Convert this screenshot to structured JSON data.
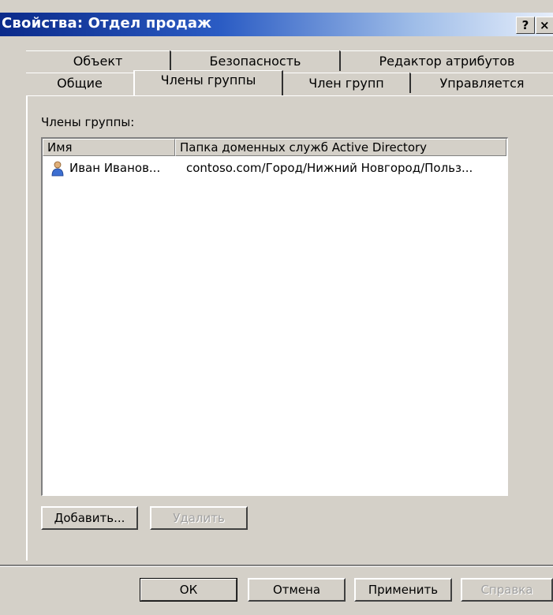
{
  "window": {
    "title": "Свойства: Отдел продаж",
    "help_label": "?",
    "close_label": "×"
  },
  "tabs": {
    "row1": [
      {
        "label": "Объект"
      },
      {
        "label": "Безопасность"
      },
      {
        "label": "Редактор атрибутов"
      }
    ],
    "row2": [
      {
        "label": "Общие"
      },
      {
        "label": "Члены группы",
        "active": true
      },
      {
        "label": "Член групп"
      },
      {
        "label": "Управляется"
      }
    ]
  },
  "members": {
    "caption": "Члены группы:",
    "columns": [
      "Имя",
      "Папка доменных служб Active Directory"
    ],
    "rows": [
      {
        "name": "Иван Иванов...",
        "folder": "contoso.com/Город/Нижний Новгород/Польз...",
        "icon": "user-icon"
      }
    ]
  },
  "buttons": {
    "add": "Добавить...",
    "remove": "Удалить",
    "ok": "ОК",
    "cancel": "Отмена",
    "apply": "Применить",
    "help": "Справка"
  }
}
